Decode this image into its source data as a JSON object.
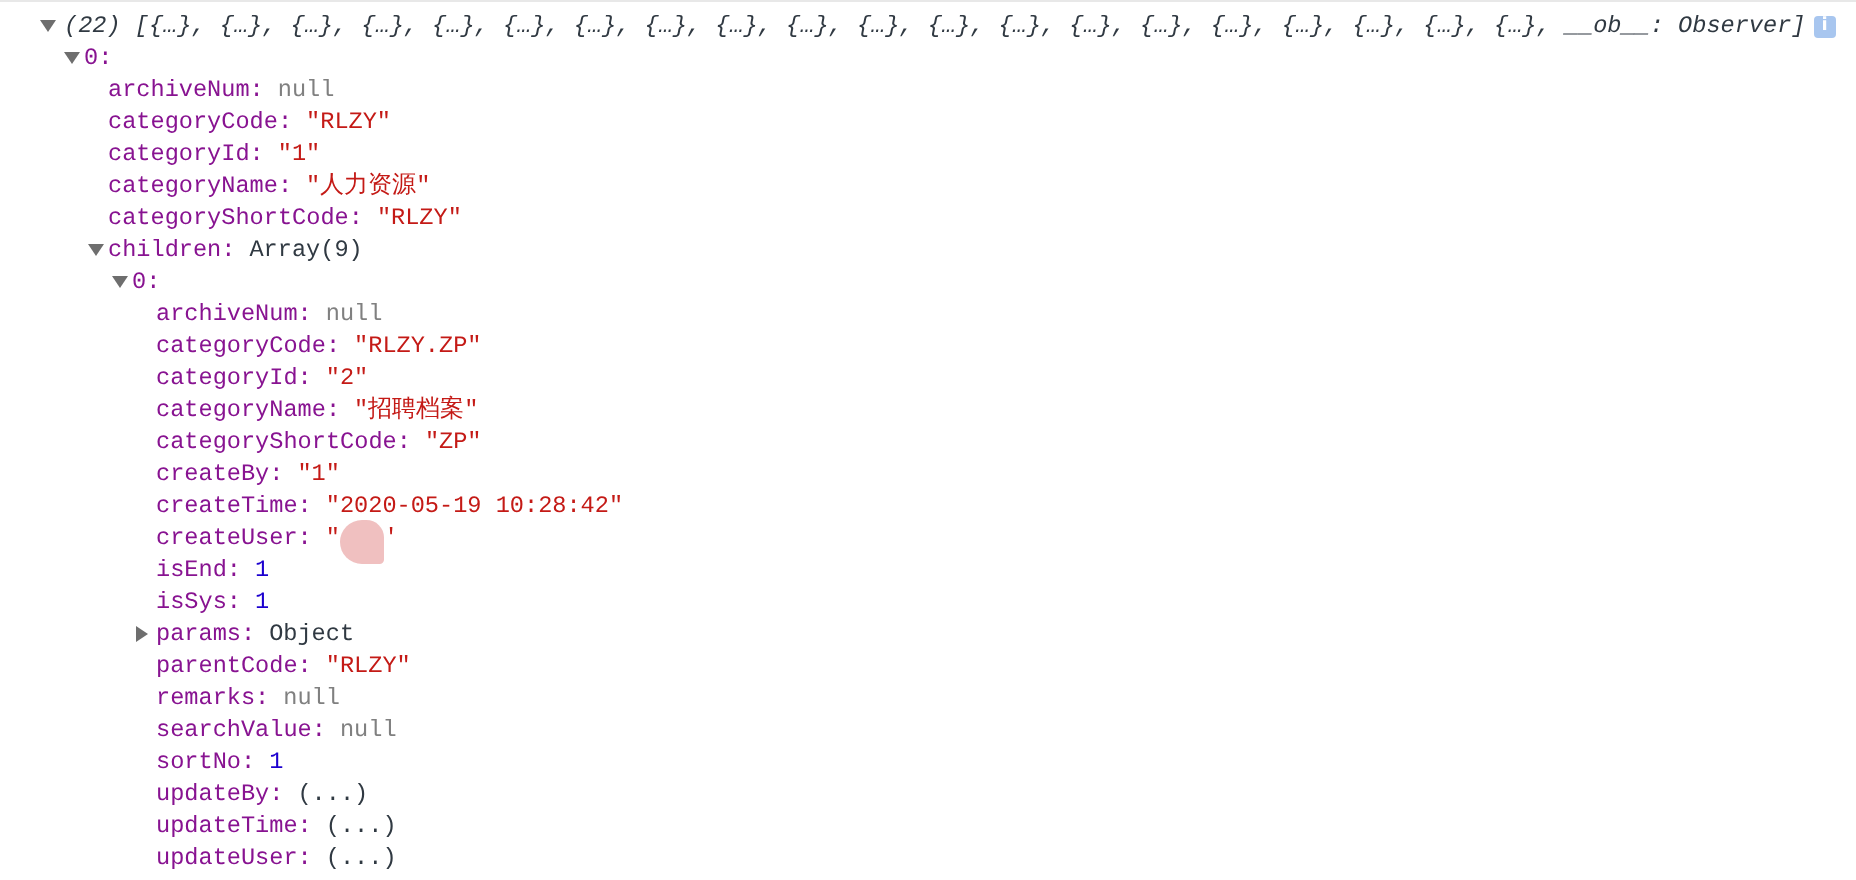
{
  "console_entry": {
    "expanded": true,
    "summary": "(22) [{…}, {…}, {…}, {…}, {…}, {…}, {…}, {…}, {…}, {…}, {…}, {…}, {…}, {…}, {…}, {…}, {…}, {…}, {…}, {…}, __ob__: Observer]",
    "info_badge": "i",
    "children": [
      {
        "key": "0:",
        "expanded": true,
        "children": [
          {
            "key": "archiveNum:",
            "value": "null",
            "kind": "null"
          },
          {
            "key": "categoryCode:",
            "value": "\"RLZY\"",
            "kind": "string"
          },
          {
            "key": "categoryId:",
            "value": "\"1\"",
            "kind": "string"
          },
          {
            "key": "categoryName:",
            "value": "\"人力资源\"",
            "kind": "string"
          },
          {
            "key": "categoryShortCode:",
            "value": "\"RLZY\"",
            "kind": "string"
          },
          {
            "key": "children:",
            "value": "Array(9)",
            "kind": "object",
            "expanded": true,
            "children": [
              {
                "key": "0:",
                "expanded": true,
                "children": [
                  {
                    "key": "archiveNum:",
                    "value": "null",
                    "kind": "null"
                  },
                  {
                    "key": "categoryCode:",
                    "value": "\"RLZY.ZP\"",
                    "kind": "string"
                  },
                  {
                    "key": "categoryId:",
                    "value": "\"2\"",
                    "kind": "string"
                  },
                  {
                    "key": "categoryName:",
                    "value": "\"招聘档案\"",
                    "kind": "string"
                  },
                  {
                    "key": "categoryShortCode:",
                    "value": "\"ZP\"",
                    "kind": "string"
                  },
                  {
                    "key": "createBy:",
                    "value": "\"1\"",
                    "kind": "string"
                  },
                  {
                    "key": "createTime:",
                    "value": "\"2020-05-19 10:28:42\"",
                    "kind": "string"
                  },
                  {
                    "key": "createUser:",
                    "value": "\"",
                    "value_end": "'",
                    "kind": "redacted"
                  },
                  {
                    "key": "isEnd:",
                    "value": "1",
                    "kind": "number"
                  },
                  {
                    "key": "isSys:",
                    "value": "1",
                    "kind": "number"
                  },
                  {
                    "key": "params:",
                    "value": "Object",
                    "kind": "object",
                    "expanded": false
                  },
                  {
                    "key": "parentCode:",
                    "value": "\"RLZY\"",
                    "kind": "string"
                  },
                  {
                    "key": "remarks:",
                    "value": "null",
                    "kind": "null"
                  },
                  {
                    "key": "searchValue:",
                    "value": "null",
                    "kind": "null"
                  },
                  {
                    "key": "sortNo:",
                    "value": "1",
                    "kind": "number"
                  },
                  {
                    "key": "updateBy:",
                    "value": "(...)",
                    "kind": "getter"
                  },
                  {
                    "key": "updateTime:",
                    "value": "(...)",
                    "kind": "getter"
                  },
                  {
                    "key": "updateUser:",
                    "value": "(...)",
                    "kind": "getter"
                  }
                ]
              }
            ]
          }
        ]
      }
    ]
  }
}
